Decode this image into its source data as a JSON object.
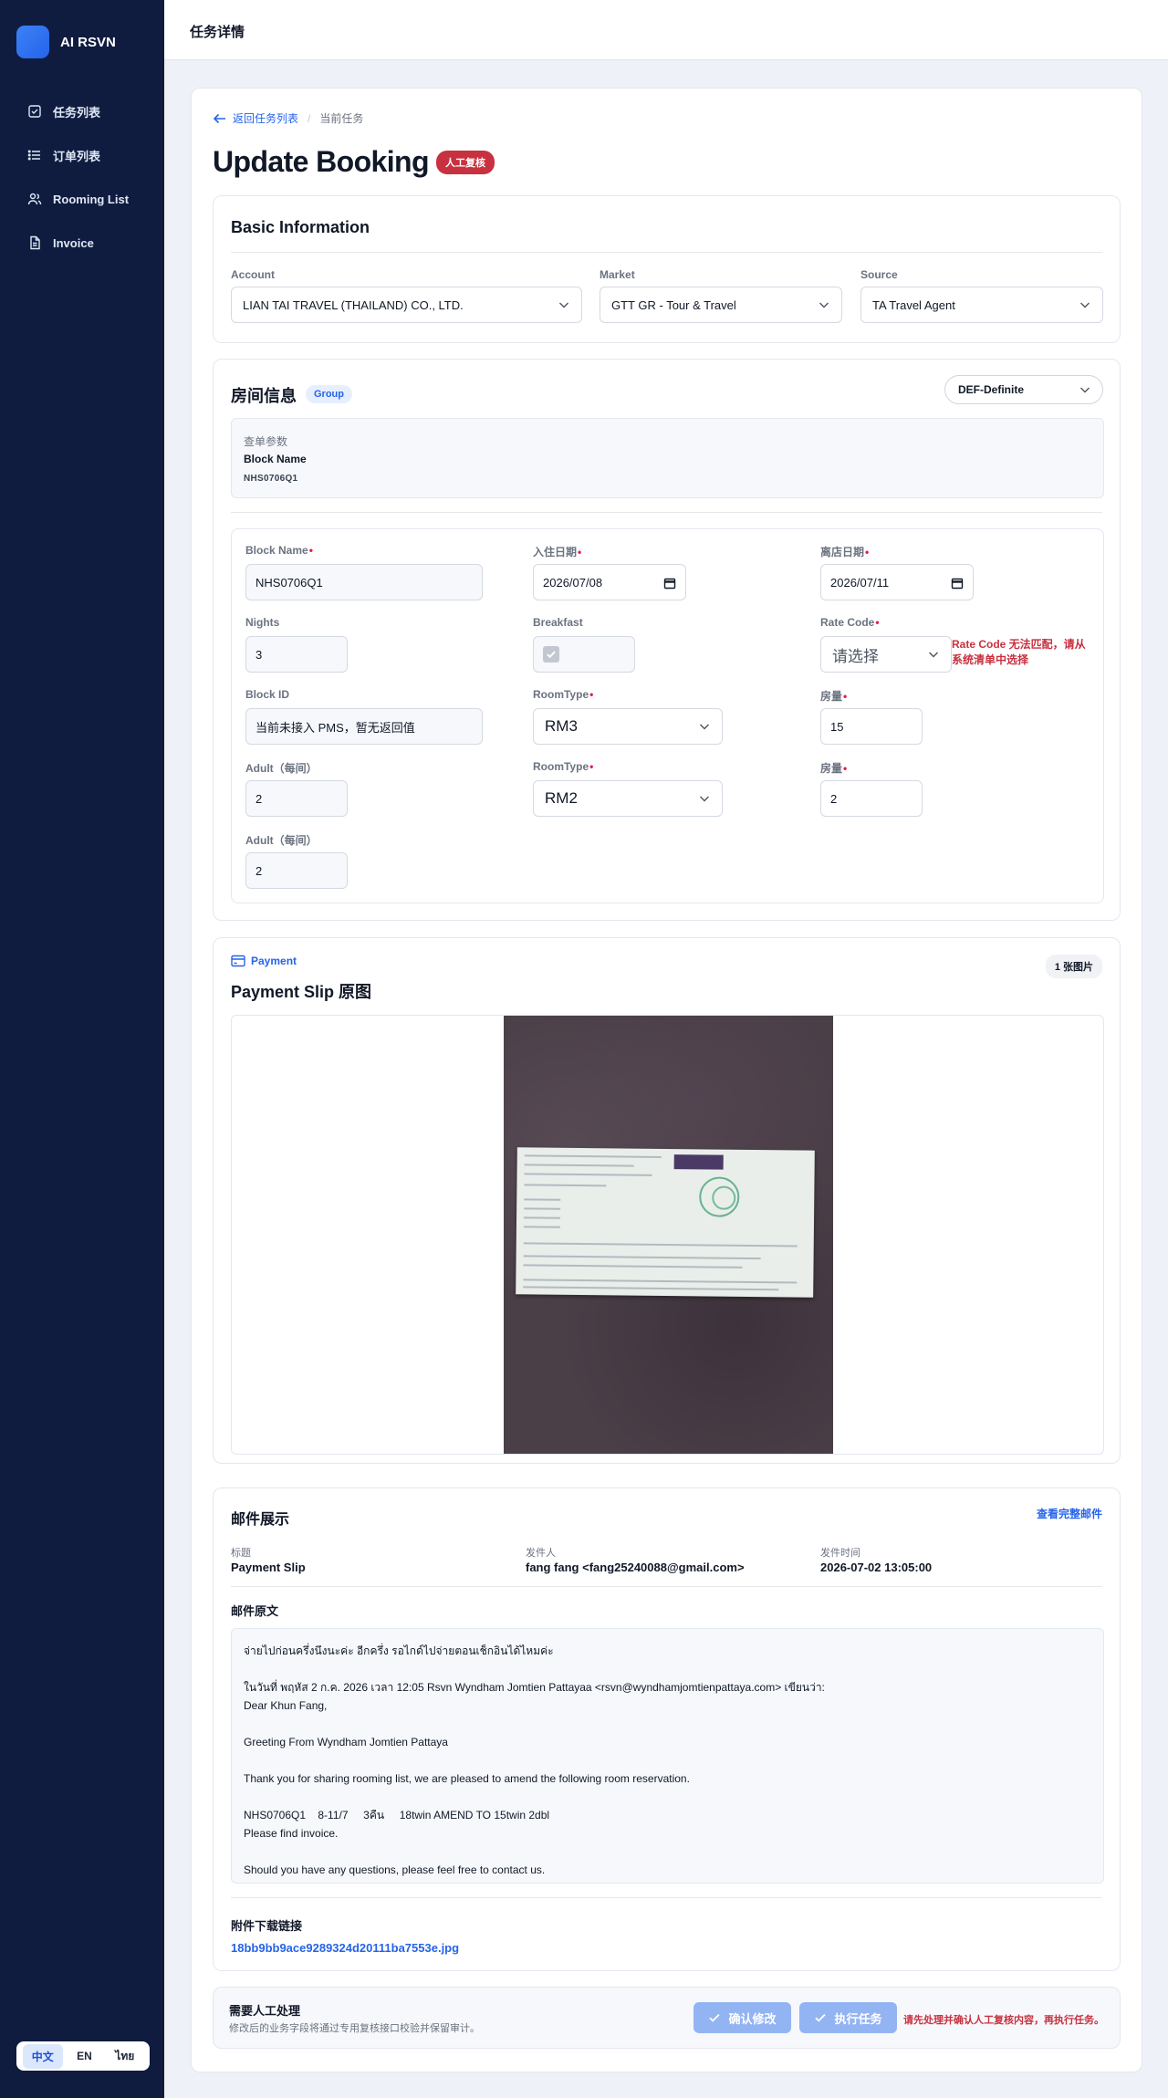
{
  "app": {
    "name": "AI RSVN"
  },
  "sidebar": {
    "items": [
      {
        "label": "任务列表",
        "icon": "checklist-icon"
      },
      {
        "label": "订单列表",
        "icon": "list-icon"
      },
      {
        "label": "Rooming List",
        "icon": "users-icon"
      },
      {
        "label": "Invoice",
        "icon": "document-icon"
      }
    ],
    "languages": [
      "中文",
      "EN",
      "ไทย"
    ],
    "active_language": "中文"
  },
  "topbar": {
    "title": "任务详情"
  },
  "breadcrumb": {
    "back_label": "返回任务列表",
    "current": "当前任务"
  },
  "page": {
    "title": "Update Booking",
    "badge": "人工复核"
  },
  "basic": {
    "title": "Basic Information",
    "account": {
      "label": "Account",
      "value": "LIAN TAI TRAVEL (THAILAND) CO., LTD."
    },
    "market": {
      "label": "Market",
      "value": "GTT  GR - Tour & Travel"
    },
    "source": {
      "label": "Source",
      "value": "TA  Travel Agent"
    }
  },
  "room": {
    "title": "房间信息",
    "badge": "Group",
    "status": "DEF-Definite",
    "query": {
      "label": "查单参数",
      "name": "Block Name",
      "value": "NHS0706Q1"
    },
    "form": {
      "block_name": {
        "label": "Block Name",
        "value": "NHS0706Q1"
      },
      "checkin": {
        "label": "入住日期",
        "value": "2026/07/08"
      },
      "checkout": {
        "label": "离店日期",
        "value": "2026/07/11"
      },
      "nights": {
        "label": "Nights",
        "value": "3"
      },
      "breakfast": {
        "label": "Breakfast",
        "checked": true
      },
      "rate_code": {
        "label": "Rate Code",
        "placeholder": "请选择",
        "warning": "Rate Code 无法匹配，请从系统清单中选择"
      },
      "block_id": {
        "label": "Block ID",
        "value": "当前未接入 PMS，暂无返回值"
      },
      "roomtype1": {
        "label": "RoomType",
        "value": "RM3"
      },
      "qty1": {
        "label": "房量",
        "value": "15"
      },
      "adult1": {
        "label": "Adult（每间）",
        "value": "2"
      },
      "roomtype2": {
        "label": "RoomType",
        "value": "RM2"
      },
      "qty2": {
        "label": "房量",
        "value": "2"
      },
      "adult2": {
        "label": "Adult（每间）",
        "value": "2"
      }
    }
  },
  "payment": {
    "tag": "Payment",
    "title": "Payment Slip 原图",
    "count": "1 张图片"
  },
  "mail": {
    "title": "邮件展示",
    "view_full": "查看完整邮件",
    "subject": {
      "label": "标题",
      "value": "Payment Slip"
    },
    "sender": {
      "label": "发件人",
      "value": "fang fang <fang25240088@gmail.com>"
    },
    "time": {
      "label": "发件时间",
      "value": "2026-07-02 13:05:00"
    },
    "body_title": "邮件原文",
    "body": {
      "line1": "จ่ายไปก่อนครึ่งนึงนะค่ะ อีกครึ่ง รอไกด์ไปจ่ายตอนเช็กอินได้ไหมค่ะ",
      "line2": "ในวันที่ พฤหัส 2 ก.ค. 2026 เวลา 12:05 Rsvn Wyndham Jomtien Pattayaa <rsvn@wyndhamjomtienpattaya.com> เขียนว่า:",
      "line3": "Dear Khun Fang,",
      "line4": "Greeting From Wyndham Jomtien Pattaya",
      "line5": "Thank you for sharing rooming list, we are pleased to amend the following room reservation.",
      "line6": "NHS0706Q1    8-11/7     3คืน     18twin AMEND TO 15twin 2dbl",
      "line7": "Please find invoice.",
      "line8": "Should you have any questions, please feel free to contact us."
    },
    "attach_title": "附件下载链接",
    "attach_link": "18bb9bb9ace9289324d20111ba7553e.jpg"
  },
  "action": {
    "title": "需要人工处理",
    "desc": "修改后的业务字段将通过专用复核接口校验并保留审计。",
    "confirm": "确认修改",
    "execute": "执行任务",
    "warning": "请先处理并确认人工复核内容，再执行任务。"
  },
  "colors": {
    "sidebar": "#0f1c3f",
    "accent": "#2563eb",
    "danger": "#c8313f",
    "button_disabled": "#93b4f3"
  }
}
